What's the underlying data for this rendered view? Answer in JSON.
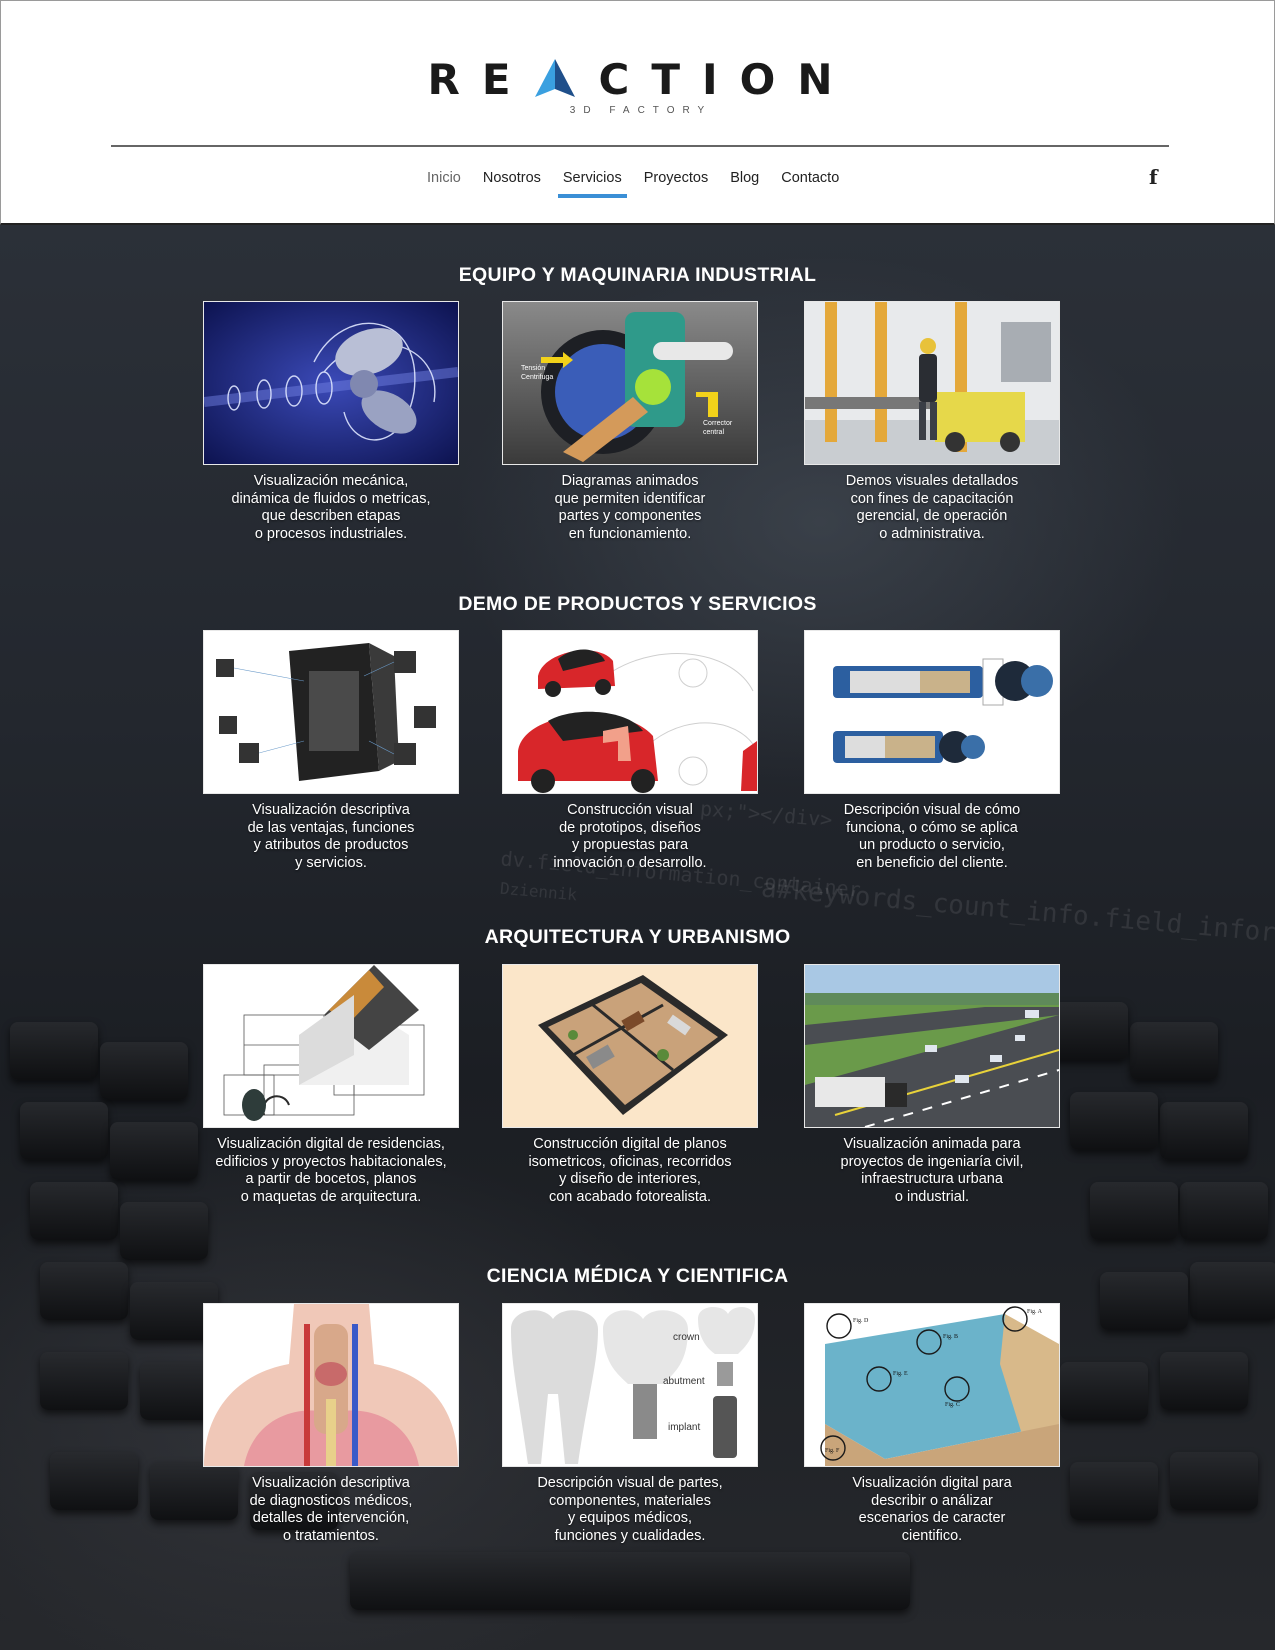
{
  "brand": {
    "logo_left": "RE",
    "logo_right": "CTION",
    "tagline": "3D FACTORY"
  },
  "nav": {
    "items": [
      {
        "label": "Inicio"
      },
      {
        "label": "Nosotros"
      },
      {
        "label": "Servicios",
        "active": true
      },
      {
        "label": "Proyectos"
      },
      {
        "label": "Blog"
      },
      {
        "label": "Contacto"
      }
    ],
    "facebook_icon": "facebook-icon",
    "accent": "#3a8fd6"
  },
  "background": {
    "code_line_1": "a#keywords_count_info.field_information...",
    "code_line_2": "dv.field_information_container",
    "code_line_3": "px;\"></div>",
    "code_line_4": "Dziennik"
  },
  "sections": [
    {
      "title": "EQUIPO Y MAQUINARIA INDUSTRIAL",
      "cards": [
        {
          "caption": "Visualización mecánica,\ndinámica de fluidos o metricas,\nque describen etapas\no procesos industriales.",
          "image": "propeller-image"
        },
        {
          "caption": "Diagramas animados\nque permiten identificar\npartes y componentes\nen funcionamiento.",
          "image": "mechanism-diagram-image",
          "labels": [
            "Tensión",
            "Centrifuga",
            "Corrector",
            "central"
          ]
        },
        {
          "caption": "Demos visuales detallados\ncon fines de capacitación\ngerencial, de operación\no administrativa.",
          "image": "industrial-worker-image"
        }
      ]
    },
    {
      "title": "DEMO DE PRODUCTOS Y SERVICIOS",
      "cards": [
        {
          "caption": "Visualización descriptiva\nde las ventajas, funciones\ny atributos de productos\ny servicios.",
          "image": "computer-case-image"
        },
        {
          "caption": "Construcción visual\nde prototipos, diseños\ny propuestas para\ninnovación o desarrollo.",
          "image": "concept-car-image"
        },
        {
          "caption": "Descripción visual de cómo\nfunciona, o cómo se aplica\nun producto o servicio,\nen beneficio del cliente.",
          "image": "cylinder-cutaway-image"
        }
      ]
    },
    {
      "title": "ARQUITECTURA Y URBANISMO",
      "cards": [
        {
          "caption": "Visualización digital de residencias,\nedificios y proyectos habitacionales,\na partir de bocetos, planos\no maquetas de arquitectura.",
          "image": "house-blueprint-image"
        },
        {
          "caption": "Construcción digital de planos\nisometricos, oficinas, recorridos\ny diseño de interiores,\ncon acabado fotorealista.",
          "image": "floor-plan-image"
        },
        {
          "caption": "Visualización animada para\nproyectos de ingeniaría civil,\ninfraestructura urbana\no industrial.",
          "image": "highway-render-image"
        }
      ]
    },
    {
      "title": "CIENCIA MÉDICA Y CIENTIFICA",
      "cards": [
        {
          "caption": "Visualización descriptiva\nde diagnosticos médicos,\ndetalles de intervención,\no tratamientos.",
          "image": "anatomy-image"
        },
        {
          "caption": "Descripción visual de partes,\ncomponentes, materiales\ny equipos médicos,\nfunciones y cualidades.",
          "image": "dental-implant-image",
          "labels": [
            "crown",
            "abutment",
            "implant"
          ]
        },
        {
          "caption": "Visualización digital para\ndescribir o análizar\nescenarios de caracter\ncientifico.",
          "image": "ocean-cross-section-image",
          "labels": [
            "Fig. D",
            "Fig. A",
            "Fig. B",
            "Fig. E",
            "Fig. C",
            "Fig. F"
          ]
        }
      ]
    }
  ]
}
